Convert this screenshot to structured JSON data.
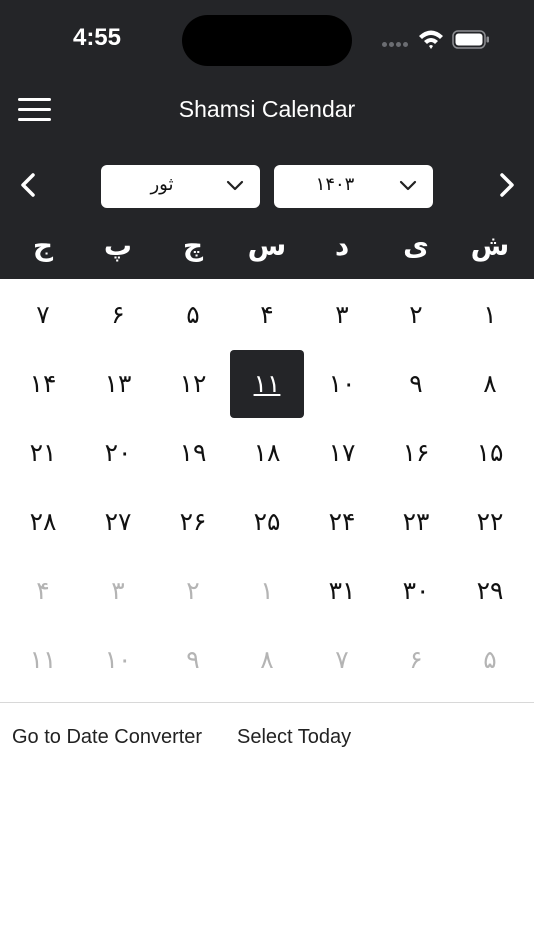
{
  "status_bar": {
    "time": "4:55"
  },
  "header": {
    "title": "Shamsi Calendar"
  },
  "selectors": {
    "month": "ثور",
    "year": "۱۴۰۳"
  },
  "weekdays": [
    "ش",
    "ی",
    "د",
    "س",
    "چ",
    "پ",
    "ج"
  ],
  "calendar": {
    "selected_day": "۱۱",
    "weeks": [
      [
        {
          "d": "۱",
          "o": false
        },
        {
          "d": "۲",
          "o": false
        },
        {
          "d": "۳",
          "o": false
        },
        {
          "d": "۴",
          "o": false
        },
        {
          "d": "۵",
          "o": false
        },
        {
          "d": "۶",
          "o": false
        },
        {
          "d": "۷",
          "o": false
        }
      ],
      [
        {
          "d": "۸",
          "o": false
        },
        {
          "d": "۹",
          "o": false
        },
        {
          "d": "۱۰",
          "o": false
        },
        {
          "d": "۱۱",
          "o": false,
          "sel": true
        },
        {
          "d": "۱۲",
          "o": false
        },
        {
          "d": "۱۳",
          "o": false
        },
        {
          "d": "۱۴",
          "o": false
        }
      ],
      [
        {
          "d": "۱۵",
          "o": false
        },
        {
          "d": "۱۶",
          "o": false
        },
        {
          "d": "۱۷",
          "o": false
        },
        {
          "d": "۱۸",
          "o": false
        },
        {
          "d": "۱۹",
          "o": false
        },
        {
          "d": "۲۰",
          "o": false
        },
        {
          "d": "۲۱",
          "o": false
        }
      ],
      [
        {
          "d": "۲۲",
          "o": false
        },
        {
          "d": "۲۳",
          "o": false
        },
        {
          "d": "۲۴",
          "o": false
        },
        {
          "d": "۲۵",
          "o": false
        },
        {
          "d": "۲۶",
          "o": false
        },
        {
          "d": "۲۷",
          "o": false
        },
        {
          "d": "۲۸",
          "o": false
        }
      ],
      [
        {
          "d": "۲۹",
          "o": false
        },
        {
          "d": "۳۰",
          "o": false
        },
        {
          "d": "۳۱",
          "o": false
        },
        {
          "d": "۱",
          "o": true
        },
        {
          "d": "۲",
          "o": true
        },
        {
          "d": "۳",
          "o": true
        },
        {
          "d": "۴",
          "o": true
        }
      ],
      [
        {
          "d": "۵",
          "o": true
        },
        {
          "d": "۶",
          "o": true
        },
        {
          "d": "۷",
          "o": true
        },
        {
          "d": "۸",
          "o": true
        },
        {
          "d": "۹",
          "o": true
        },
        {
          "d": "۱۰",
          "o": true
        },
        {
          "d": "۱۱",
          "o": true
        }
      ]
    ]
  },
  "footer": {
    "converter_label": "Go to Date Converter",
    "today_label": "Select Today"
  },
  "icons": {
    "menu": "hamburger-menu-icon",
    "prev": "chevron-left-icon",
    "next": "chevron-right-icon",
    "dropdown": "chevron-down-icon",
    "wifi": "wifi-icon",
    "battery": "battery-icon",
    "signal": "cellular-signal-icon"
  },
  "colors": {
    "header_bg": "#242528",
    "selected_bg": "#242528",
    "other_month_text": "#b4b4b4"
  }
}
